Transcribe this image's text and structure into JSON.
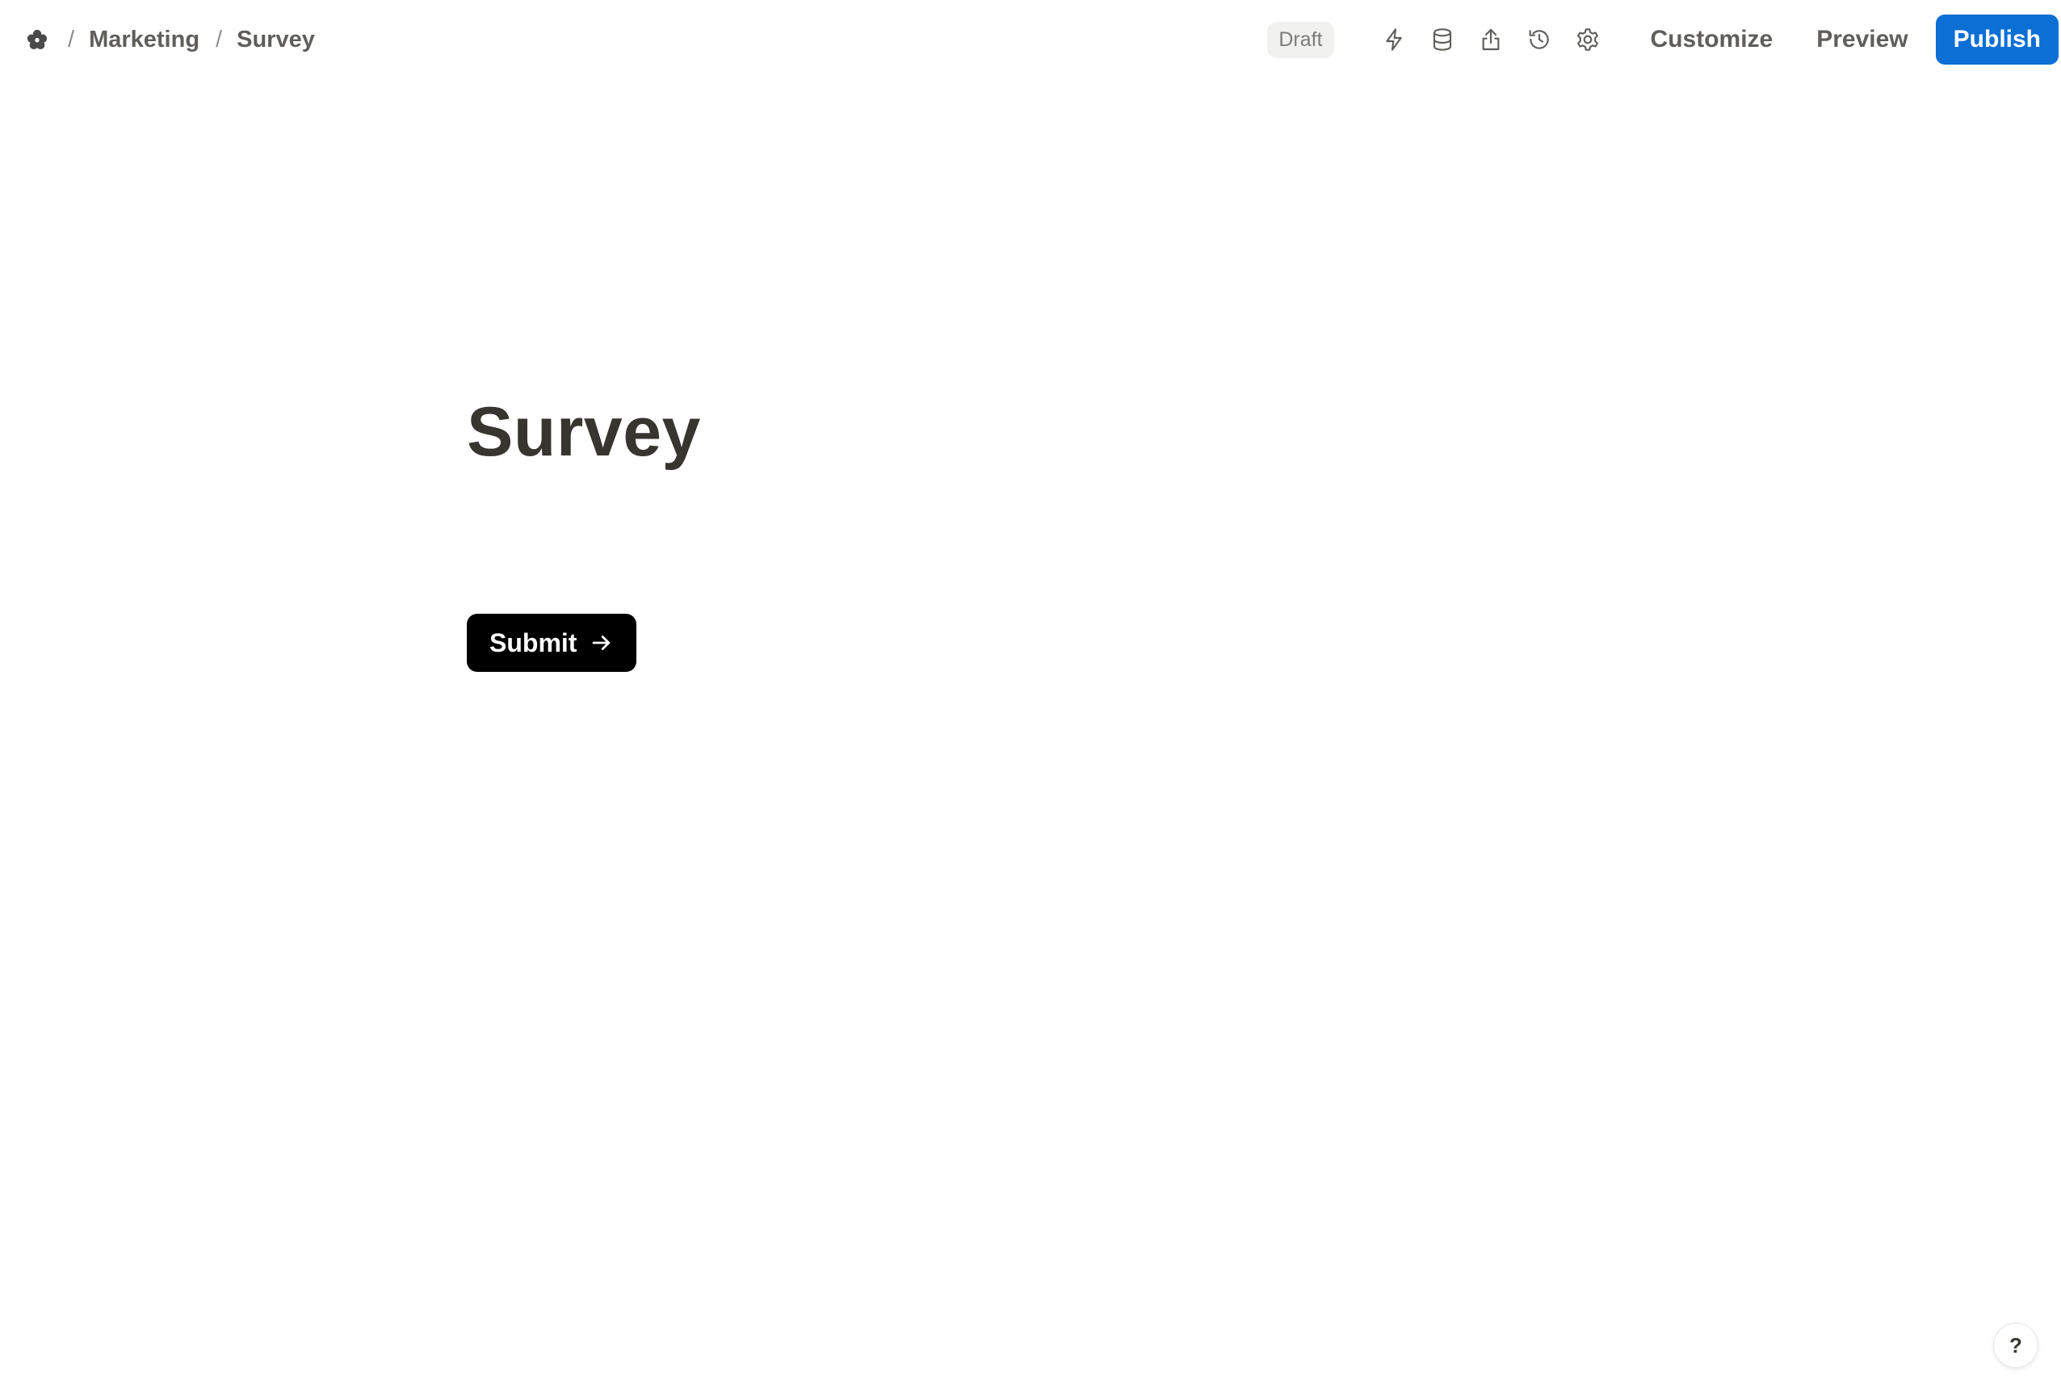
{
  "breadcrumb": {
    "logo_icon": "flower-logo-icon",
    "separator": "/",
    "items": [
      "Marketing",
      "Survey"
    ]
  },
  "header": {
    "status": "Draft",
    "icons": [
      "lightning-icon",
      "database-icon",
      "share-icon",
      "history-icon",
      "settings-icon"
    ],
    "customize_label": "Customize",
    "preview_label": "Preview",
    "publish_label": "Publish"
  },
  "form": {
    "title": "Survey",
    "submit_label": "Submit",
    "submit_icon": "arrow-right-icon"
  },
  "help": {
    "label": "?"
  },
  "colors": {
    "publish": "#0b6fd6",
    "submit": "#000000",
    "text": "#37352f"
  }
}
